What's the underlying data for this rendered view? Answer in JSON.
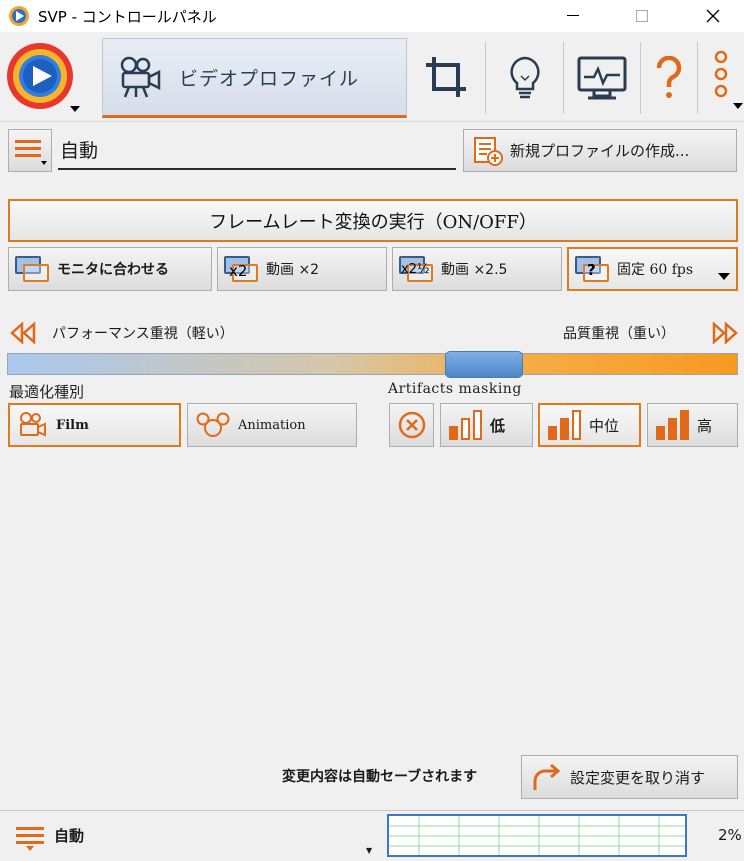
{
  "window": {
    "title": "SVP - コントロールパネル"
  },
  "toolbar": {
    "tab_video_label": "ビデオプロファイル",
    "icons": [
      "svp-logo-icon",
      "video-camera-icon",
      "crop-icon",
      "lightbulb-icon",
      "monitor-icon",
      "help-icon",
      "more-icon"
    ]
  },
  "profile": {
    "name": "自動",
    "new_profile_label": "新規プロファイルの作成..."
  },
  "frame_rate": {
    "toggle_label": "フレームレート変換の実行（ON/OFF）",
    "modes": [
      {
        "label": "モニタに合わせる",
        "icon_text": ""
      },
      {
        "label": "動画 ×2",
        "icon_text": "x2"
      },
      {
        "label": "動画 ×2.5",
        "icon_text": "x2½"
      },
      {
        "label": "固定 60 fps",
        "icon_text": "?"
      }
    ],
    "selected_mode": 3
  },
  "slider": {
    "left_label": "パフォーマンス重視（軽い）",
    "right_label": "品質重視（重い）",
    "value": 0.67
  },
  "optimization": {
    "label": "最適化種別",
    "options": [
      "Film",
      "Animation"
    ],
    "selected": 0
  },
  "artifacts": {
    "label": "Artifacts masking",
    "options": [
      "低",
      "中位",
      "高"
    ],
    "selected": 1
  },
  "footer": {
    "autosave_note": "変更内容は自動セーブされます",
    "undo_label": "設定変更を取り消す"
  },
  "statusbar": {
    "profile": "自動",
    "cpu_load": "2%"
  },
  "colors": {
    "accent": "#e07a1f",
    "selection_blue": "#4b87c8"
  }
}
